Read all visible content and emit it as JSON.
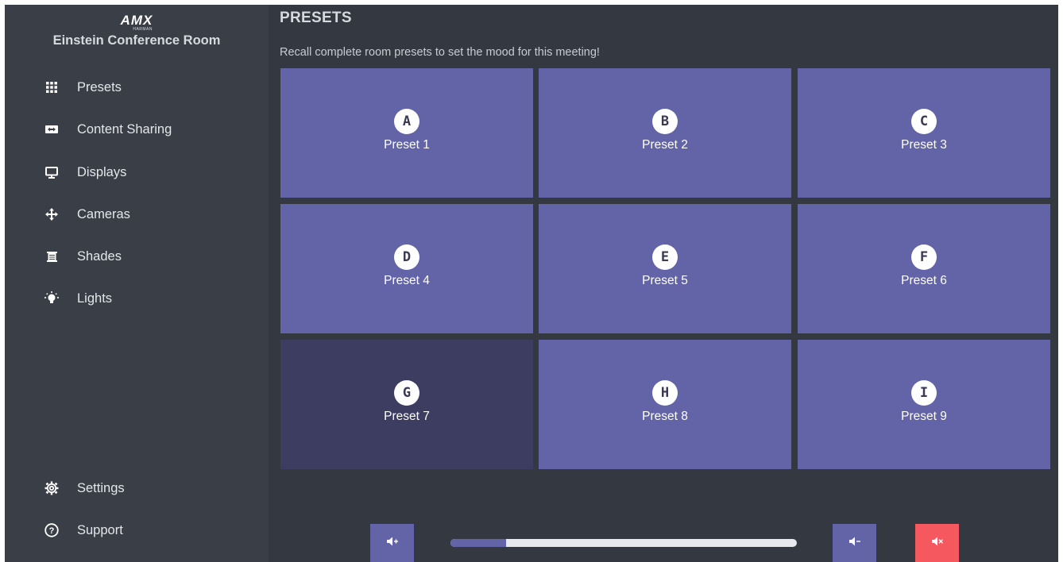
{
  "brand": {
    "logo_text": "AMX",
    "logo_subtext": "HARMAN",
    "room_name": "Einstein Conference Room"
  },
  "sidebar": {
    "items": [
      {
        "label": "Presets",
        "icon": "grid-icon"
      },
      {
        "label": "Content Sharing",
        "icon": "content-share-icon"
      },
      {
        "label": "Displays",
        "icon": "monitor-icon"
      },
      {
        "label": "Cameras",
        "icon": "move-arrows-icon"
      },
      {
        "label": "Shades",
        "icon": "shades-icon"
      },
      {
        "label": "Lights",
        "icon": "lightbulb-icon"
      }
    ],
    "footer_items": [
      {
        "label": "Settings",
        "icon": "gear-icon"
      },
      {
        "label": "Support",
        "icon": "help-circle-icon"
      }
    ]
  },
  "main": {
    "title": "PRESETS",
    "subtitle": "Recall complete room presets to set the mood for this meeting!",
    "presets": [
      {
        "letter": "A",
        "label": "Preset 1",
        "active": false
      },
      {
        "letter": "B",
        "label": "Preset 2",
        "active": false
      },
      {
        "letter": "C",
        "label": "Preset 3",
        "active": false
      },
      {
        "letter": "D",
        "label": "Preset 4",
        "active": false
      },
      {
        "letter": "E",
        "label": "Preset 5",
        "active": false
      },
      {
        "letter": "F",
        "label": "Preset 6",
        "active": false
      },
      {
        "letter": "G",
        "label": "Preset 7",
        "active": true
      },
      {
        "letter": "H",
        "label": "Preset 8",
        "active": false
      },
      {
        "letter": "I",
        "label": "Preset 9",
        "active": false
      }
    ]
  },
  "volume": {
    "level_fraction": 0.16,
    "buttons": [
      "volume-up-icon",
      "volume-down-icon",
      "volume-mute-icon"
    ]
  },
  "colors": {
    "tile": "#6264a7",
    "tile_active": "#3d3d61",
    "mute": "#f5585e",
    "background": "#343841",
    "sidebar": "#393e47"
  }
}
